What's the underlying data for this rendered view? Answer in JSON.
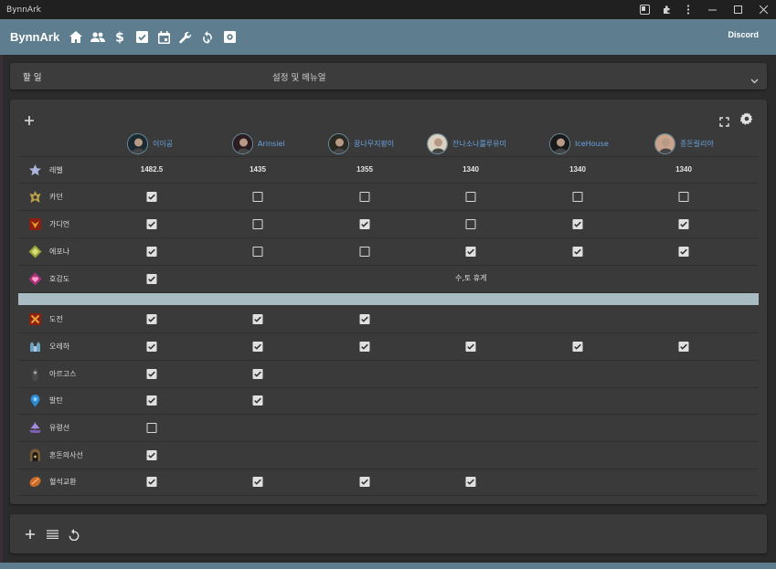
{
  "window": {
    "title": "BynnArk"
  },
  "app": {
    "brand": "BynnArk",
    "nav_icons": [
      "home-icon",
      "people-icon",
      "dollar-icon",
      "checkbox-icon",
      "calendar-icon",
      "wrench-icon",
      "sync-icon",
      "settings-box-icon"
    ],
    "discord_label": "Discord",
    "accent": "#5e7e90"
  },
  "panel": {
    "title": "할 일",
    "subtitle": "설정 및 메뉴얼"
  },
  "characters": [
    {
      "name": "이이공",
      "level": "1482.5"
    },
    {
      "name": "Arinsiel",
      "level": "1435"
    },
    {
      "name": "꿍나무지팡이",
      "level": "1355"
    },
    {
      "name": "잔나소나룰루유미",
      "level": "1340"
    },
    {
      "name": "IceHouse",
      "level": "1340"
    },
    {
      "name": "종돈릴리아",
      "level": "1340"
    }
  ],
  "level_label": "레벨",
  "rows": [
    {
      "label": "카던",
      "icon": "chaos-dungeon-icon",
      "checks": [
        1,
        0,
        0,
        0,
        0,
        0
      ]
    },
    {
      "label": "가디언",
      "icon": "guardian-icon",
      "checks": [
        1,
        0,
        1,
        0,
        1,
        1
      ]
    },
    {
      "label": "에포나",
      "icon": "epona-icon",
      "checks": [
        1,
        0,
        0,
        1,
        1,
        1
      ]
    },
    {
      "label": "호감도",
      "icon": "rapport-icon",
      "checks": [
        1,
        null,
        null,
        null,
        null,
        null
      ],
      "note": "수,토 휴게"
    }
  ],
  "weekly_rows": [
    {
      "label": "도전",
      "icon": "challenge-icon",
      "checks": [
        1,
        1,
        1,
        null,
        null,
        null
      ]
    },
    {
      "label": "오레하",
      "icon": "oreha-icon",
      "checks": [
        1,
        1,
        1,
        1,
        1,
        1
      ]
    },
    {
      "label": "아르고스",
      "icon": "argos-icon",
      "checks": [
        1,
        1,
        null,
        null,
        null,
        null
      ]
    },
    {
      "label": "발탄",
      "icon": "valtan-icon",
      "checks": [
        1,
        1,
        null,
        null,
        null,
        null
      ]
    },
    {
      "label": "유령선",
      "icon": "ghost-ship-icon",
      "checks": [
        0,
        null,
        null,
        null,
        null,
        null
      ]
    },
    {
      "label": "혼돈의사선",
      "icon": "chaos-gate-icon",
      "checks": [
        1,
        null,
        null,
        null,
        null,
        null
      ]
    },
    {
      "label": "혈석교환",
      "icon": "bloodstone-icon",
      "checks": [
        1,
        1,
        1,
        1,
        null,
        null
      ]
    }
  ]
}
